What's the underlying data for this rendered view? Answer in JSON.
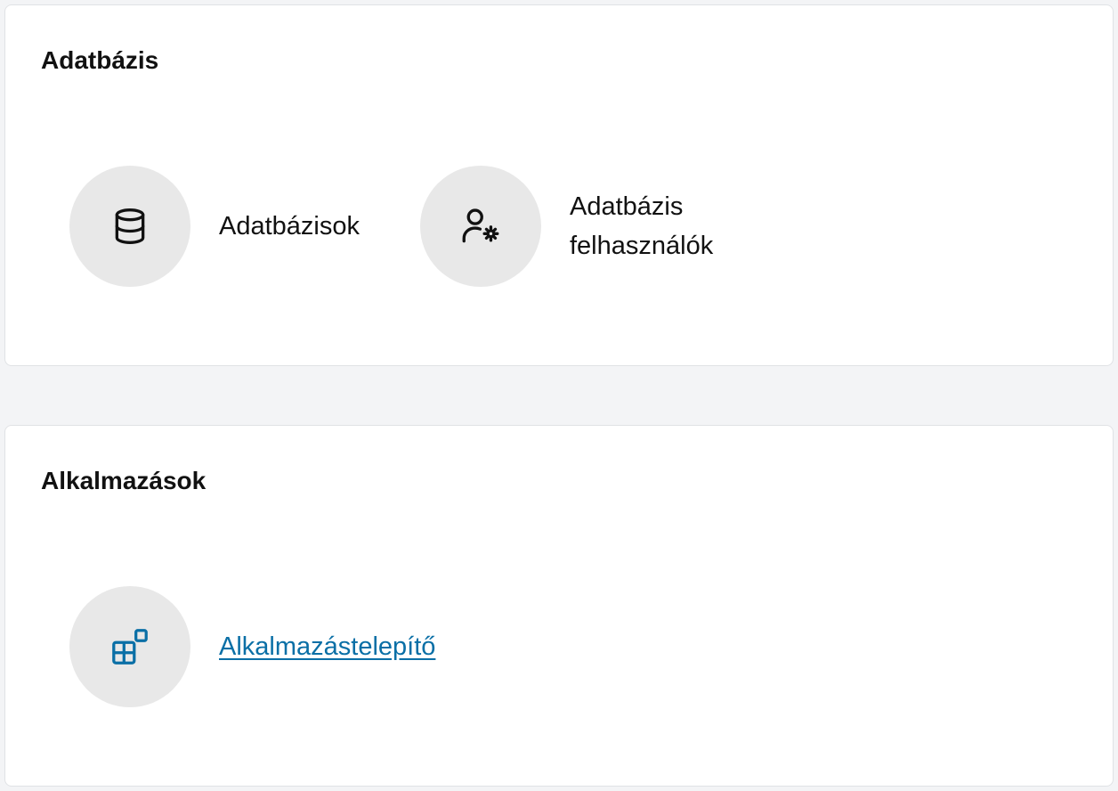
{
  "database_section": {
    "title": "Adatbázis",
    "items": [
      {
        "label": "Adatbázisok",
        "icon": "database-icon"
      },
      {
        "label": "Adatbázis felhasználók",
        "icon": "user-gear-icon"
      }
    ]
  },
  "apps_section": {
    "title": "Alkalmazások",
    "items": [
      {
        "label": "Alkalmazástelepítő",
        "icon": "apps-grid-icon",
        "link_color": "#0a6fa6"
      }
    ]
  }
}
